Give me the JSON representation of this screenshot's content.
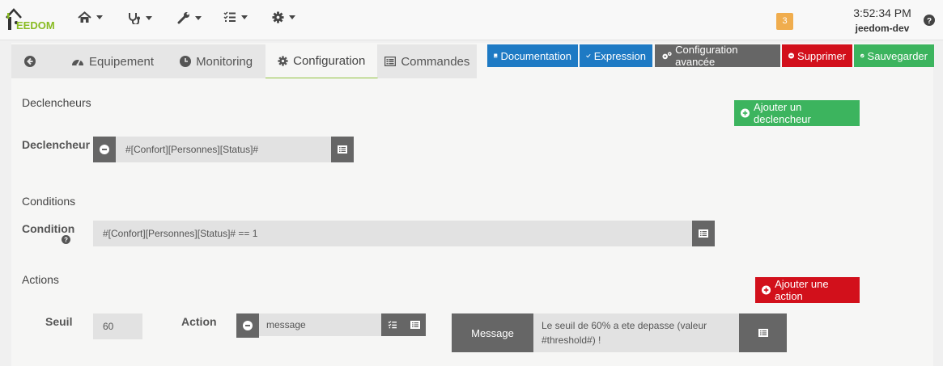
{
  "app": {
    "logo_text_left": "J",
    "logo_text_right": "EEDOM",
    "notifications_count": "3",
    "clock": "3:52:34 PM",
    "host": "jeedom-dev"
  },
  "nav": {
    "items": [
      {
        "icon": "home-icon"
      },
      {
        "icon": "stethoscope-icon"
      },
      {
        "icon": "wrench-icon"
      },
      {
        "icon": "tasks-icon"
      },
      {
        "icon": "cog-icon"
      }
    ]
  },
  "tabs": [
    {
      "label": ""
    },
    {
      "label": "Equipement"
    },
    {
      "label": "Monitoring"
    },
    {
      "label": "Configuration"
    },
    {
      "label": "Commandes"
    }
  ],
  "toolbar": {
    "documentation": "Documentation",
    "expression": "Expression",
    "advanced": "Configuration avancée",
    "delete": "Supprimer",
    "save": "Sauvegarder"
  },
  "triggers": {
    "title": "Declencheurs",
    "add_label": "Ajouter un declencheur",
    "row_label": "Declencheur",
    "value": "#[Confort][Personnes][Status]#"
  },
  "conditions": {
    "title": "Conditions",
    "row_label": "Condition",
    "value": "#[Confort][Personnes][Status]# == 1"
  },
  "actions": {
    "title": "Actions",
    "add_label": "Ajouter une action",
    "threshold_label": "Seuil",
    "threshold_value": "60",
    "action_label": "Action",
    "action_value": "message",
    "message_label": "Message",
    "message_value": "Le seuil de 60% a ete depasse (valeur #threshold#) !"
  },
  "colors": {
    "primary": "#1e7ac4",
    "success": "#3cb45e",
    "danger": "#d2101b",
    "default": "#666666",
    "warning": "#f0ad4e"
  }
}
